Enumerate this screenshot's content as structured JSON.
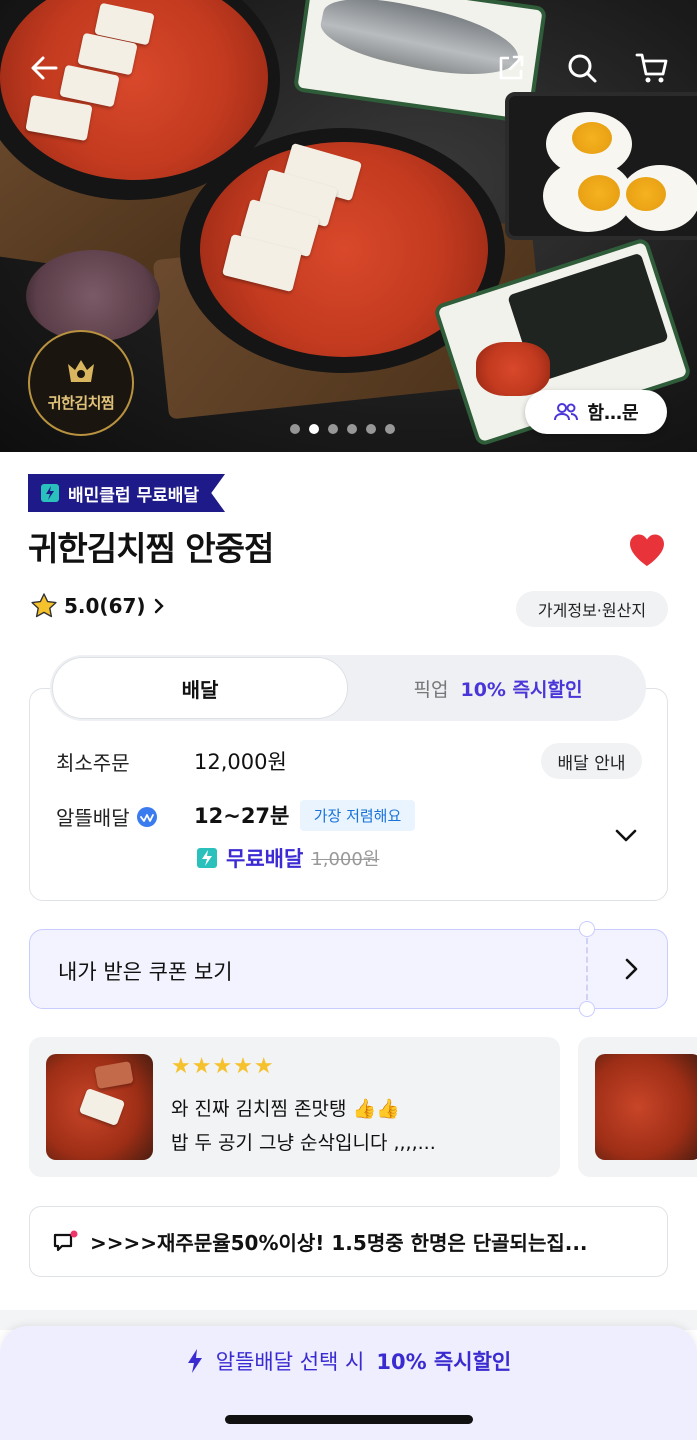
{
  "hero": {
    "logo_text": "귀한김치찜",
    "group_order_label": "함…문",
    "carousel": {
      "total": 6,
      "active_index": 1
    }
  },
  "store": {
    "club_badge": "배민클럽 무료배달",
    "name": "귀한김치찜 안중점",
    "rating": "5.0(67)",
    "info_button": "가게정보·원산지"
  },
  "order_tabs": {
    "delivery": "배달",
    "pickup": "픽업",
    "pickup_discount": "10% 즉시할인"
  },
  "delivery_info": {
    "min_order_label": "최소주문",
    "min_order_value": "12,000원",
    "guide_button": "배달 안내",
    "saver_label": "알뜰배달",
    "saver_time": "12~27분",
    "cheapest_badge": "가장 저렴해요",
    "free_delivery": "무료배달",
    "original_fee": "1,000원"
  },
  "coupon": {
    "label": "내가 받은 쿠폰 보기"
  },
  "review": {
    "stars": "★★★★★",
    "line1": "와 진짜 김치찜 존맛탱 👍👍",
    "line2": "밥 두 공기 그냥 순삭입니다 ,,,,..."
  },
  "notice": {
    "text": ">>>>재주문율50%이상! 1.5명중 한명은 단골되는집..."
  },
  "bottom_banner": {
    "text_pre": "알뜰배달 선택 시",
    "text_bold": "10% 즉시할인"
  },
  "colors": {
    "brand_purple": "#3c2bd4",
    "club_navy": "#1f1a8a",
    "heart_red": "#e8333a",
    "mint": "#2ac1bc"
  }
}
